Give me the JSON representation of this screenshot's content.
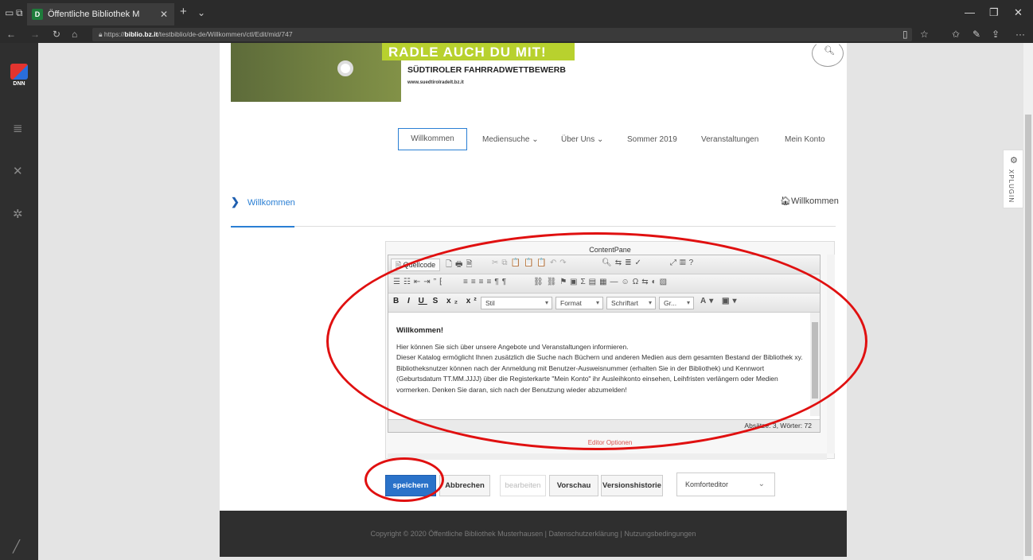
{
  "browser": {
    "tab_title": "Öffentliche Bibliothek M",
    "tab_close": "✕",
    "new_tab": "+",
    "tab_menu": "⌄",
    "url_prefix": "https://",
    "url_domain": "biblio.bz.it",
    "url_path": "/testbiblio/de-de/Willkommen/ctl/Edit/mid/747",
    "window_min": "—",
    "window_max": "❐",
    "window_close": "✕"
  },
  "sidebar": {
    "logo_text": "DNN"
  },
  "banner": {
    "slogan": "RADLE AUCH DU MIT!",
    "competition": "SÜDTIROLER FAHRRADWETTBEWERB",
    "site": "www.suedtirolradelt.bz.it"
  },
  "menu": {
    "items": [
      "Willkommen",
      "Mediensuche ⌄",
      "Über Uns ⌄",
      "Sommer 2019",
      "Veranstaltungen",
      "Mein Konto"
    ]
  },
  "breadcrumb": {
    "left": "Willkommen",
    "right": "Willkommen"
  },
  "editor": {
    "pane_title": "ContentPane",
    "source_label": "Quellcode",
    "style_select": "Stil",
    "format_select": "Format",
    "font_select": "Schriftart",
    "size_select": "Gr...",
    "heading": "Willkommen!",
    "paragraphs": [
      "Hier können Sie sich über unsere Angebote und Veranstaltungen informieren.",
      "Dieser Katalog ermöglicht Ihnen zusätzlich die Suche nach Büchern und anderen Medien aus dem gesamten Bestand der Bibliothek xy.",
      "Bibliotheksnutzer können nach der Anmeldung mit Benutzer-Ausweisnummer (erhalten Sie in der Bibliothek) und Kennwort (Geburtsdatum TT.MM.JJJJ) über die Registerkarte \"Mein Konto\" ihr Ausleihkonto einsehen, Leihfristen verlängern oder Medien vormerken. Denken Sie daran, sich nach der Benutzung wieder abzumelden!"
    ],
    "status": "Absätze: 3, Wörter: 72",
    "options_link": "Editor Optionen"
  },
  "actions": {
    "save": "speichern",
    "cancel": "Abbrechen",
    "edit": "bearbeiten",
    "preview": "Vorschau",
    "history": "Versionshistorie",
    "editor_mode": "Komforteditor"
  },
  "footer": {
    "text": "Copyright © 2020 Öffentliche Bibliothek Musterhausen   |   Datenschutzerklärung   |   Nutzungsbedingungen"
  },
  "xplugin": {
    "label": "XPLUGIN"
  },
  "colors": {
    "accent": "#2a7fd4",
    "primary_button": "#2a72c9",
    "annotation": "#e01010",
    "footer_bg": "#2f2f2f"
  }
}
